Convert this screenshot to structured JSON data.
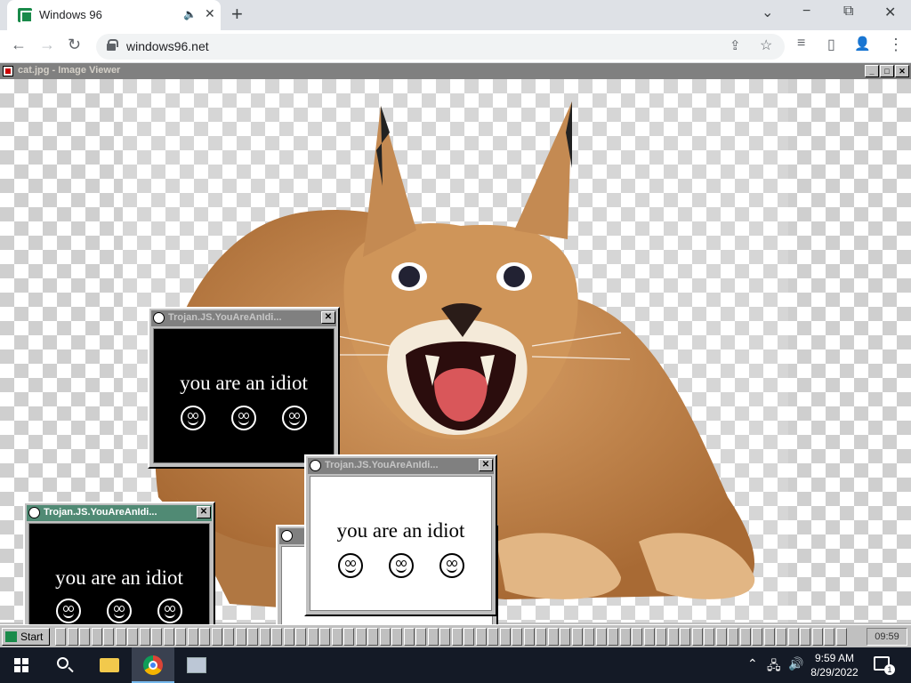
{
  "browser": {
    "tab_title": "Windows 96",
    "tab_audio_icon": "speaker-icon",
    "tab_close": "✕",
    "new_tab": "+",
    "window_controls": {
      "min": "−",
      "restore": "⧉",
      "close": "✕",
      "list": "⌄"
    },
    "url": "windows96.net",
    "nav": {
      "back": "←",
      "forward": "→",
      "reload": "↻",
      "share": "⇪",
      "star": "☆",
      "media": "≡",
      "sidepanel": "▯",
      "profile": "👤",
      "menu": "⋮"
    }
  },
  "viewer": {
    "title": "cat.jpg - Image Viewer",
    "controls": {
      "min": "_",
      "max": "□",
      "close": "✕"
    },
    "image_subject": "caracal cat on transparent background"
  },
  "popups": [
    {
      "title": "Trojan.JS.YouAreAnIdi...",
      "message": "you are an idiot",
      "theme": "black"
    },
    {
      "title": "Trojan.JS.YouAreAnIdi...",
      "message": "you are an idiot",
      "theme": "white"
    },
    {
      "title": "Trojan.JS.YouAreAnIdi...",
      "message": "you are an idiot",
      "theme": "black"
    }
  ],
  "w96_taskbar": {
    "start_label": "Start",
    "clock": "09:59"
  },
  "win_taskbar": {
    "time": "9:59 AM",
    "date": "8/29/2022",
    "notification_count": "1"
  },
  "colors": {
    "active_title": "#508a74",
    "inactive_title": "#808080",
    "w96_gray": "#c0c0c0"
  }
}
